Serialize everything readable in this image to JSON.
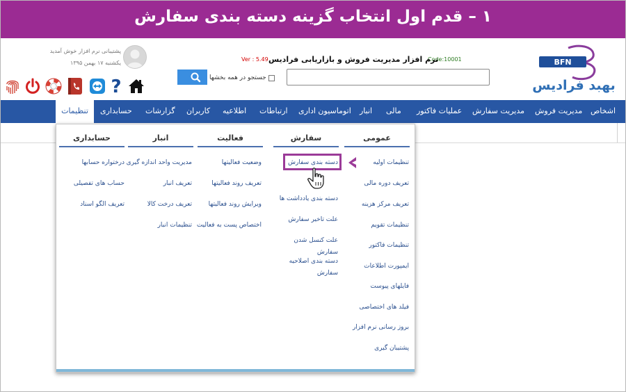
{
  "banner": {
    "title": "۱ – قدم اول انتخاب گزینه دسته بندی سفارش"
  },
  "header": {
    "code": "Code:10001",
    "app_title": "نرم افزار مدیریت فروش و بازاریابی فرادیس",
    "version": "Ver : 5.49",
    "search_placeholder": "",
    "search_all_label": "جستجو در همه بخشها",
    "welcome": "پشتیبانی نرم افزار خوش آمدید",
    "date": "یکشنبه ۱۷ بهمن ۱۳۹۵",
    "logo": {
      "badge": "BFN",
      "wordmark": "بهبد فرادیس"
    }
  },
  "toolbar_icons": [
    "home-icon",
    "help-icon",
    "teamviewer-icon",
    "phonebook-icon",
    "support-lifebuoy-icon",
    "power-icon",
    "fingerprint-icon"
  ],
  "nav": {
    "items": [
      "اشخاص",
      "مدیریت فروش",
      "مدیریت سفارش",
      "عملیات فاکتور",
      "مالی",
      "انبار",
      "اتوماسیون اداری",
      "ارتباطات",
      "اطلاعیه",
      "کاربران",
      "گزارشات",
      "حسابداری"
    ],
    "active": "تنظیمات"
  },
  "menu": {
    "columns": [
      {
        "title": "عمومی",
        "items": [
          "تنظیمات اولیه",
          "تعریف دوره مالی",
          "تعریف مرکز هزینه",
          "تنظیمات تقویم",
          "تنظیمات فاکتور",
          "ایمپورت اطلاعات",
          "فایلهای پیوست",
          "فیلد های اختصاصی",
          "بروز رسانی نرم افزار",
          "پشتیبان گیری"
        ]
      },
      {
        "title": "سفارش",
        "items": [
          "دسته بندی سفارش",
          "دسته بندی یادداشت ها",
          "علت تاخیر سفارش",
          "علت کنسل شدن",
          "سفارش",
          "دسته بندی اصلاحیه",
          "سفارش"
        ]
      },
      {
        "title": "فعالیت",
        "items": [
          "وضعیت فعالیتها",
          "تعریف روند فعالیتها",
          "ویرایش روند فعالیتها",
          "اختصاص پست به فعالیت"
        ]
      },
      {
        "title": "انبار",
        "items": [
          "مدیریت واحد اندازه گیری",
          "تعریف انبار",
          "تعریف درخت کالا",
          "تنظیمات انبار"
        ]
      },
      {
        "title": "حسابداری",
        "items": [
          "درختواره حسابها",
          "حساب های تفصیلی",
          "تعریف الگو اسناد"
        ]
      }
    ]
  },
  "colors": {
    "banner": "#9b2b93",
    "nav": "#2857a4",
    "highlight": "#9b3b98",
    "search_button": "#3a8ee0"
  }
}
